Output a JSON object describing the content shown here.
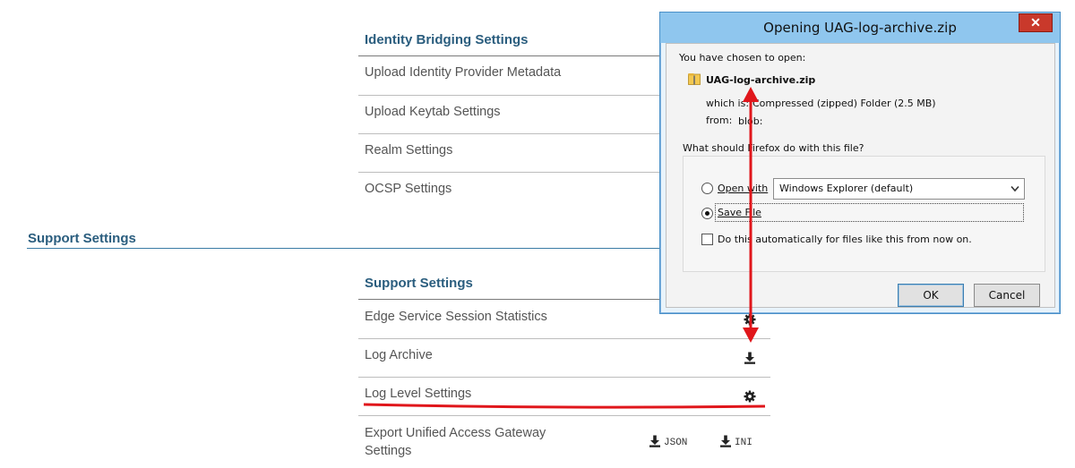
{
  "identity": {
    "header": "Identity Bridging Settings",
    "rows": [
      "Upload Identity Provider Metadata",
      "Upload Keytab Settings",
      "Realm Settings",
      "OCSP Settings"
    ]
  },
  "support_section": {
    "title": "Support Settings"
  },
  "support": {
    "header": "Support Settings",
    "rows": [
      "Edge Service Session Statistics",
      "Log Archive",
      "Log Level Settings"
    ],
    "export_label_line1": "Export Unified Access Gateway",
    "export_label_line2": "Settings",
    "export_json": "JSON",
    "export_ini": "INI"
  },
  "dialog": {
    "title": "Opening UAG-log-archive.zip",
    "close": "✕",
    "chosen_text": "You have chosen to open:",
    "file_name": "UAG-log-archive.zip",
    "which_is_label": "which is:",
    "which_is_value": "Compressed (zipped) Folder (2.5 MB)",
    "from_label": "from:",
    "from_value": "blob:",
    "question": "What should Firefox do with this file?",
    "open_with_label": "Open with",
    "open_with_value": "Windows Explorer (default)",
    "save_file_label": "Save File",
    "auto_label": "Do this automatically for files like this from now on.",
    "ok": "OK",
    "cancel": "Cancel"
  },
  "colors": {
    "annotation": "#e0161b",
    "accent": "#2a5d7e"
  }
}
